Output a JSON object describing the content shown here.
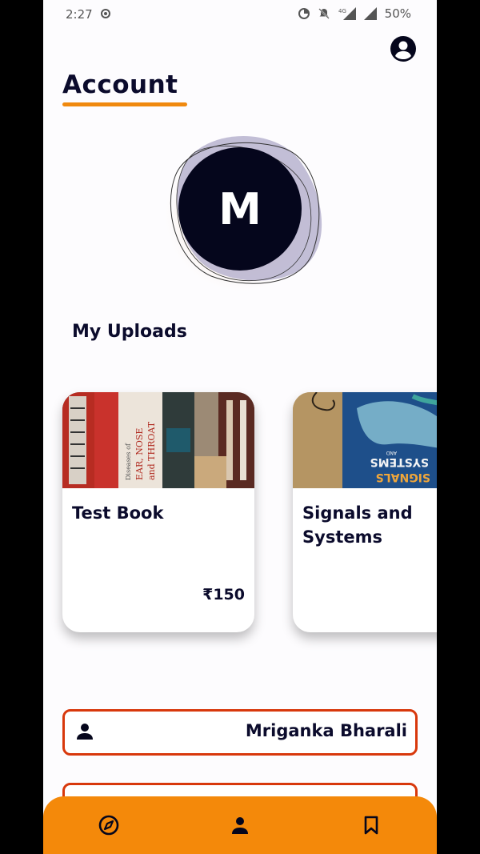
{
  "status_bar": {
    "time": "2:27",
    "battery": "50%",
    "network": "4G"
  },
  "page": {
    "title": "Account"
  },
  "avatar": {
    "initial": "M"
  },
  "uploads": {
    "heading": "My Uploads",
    "items": [
      {
        "name": "Test Book",
        "price": "₹150",
        "cover_text": [
          "Diseases of",
          "EAR, NOSE",
          "and THROAT"
        ]
      },
      {
        "name": "Signals and Systems",
        "price": "₹",
        "cover_text": [
          "SYSTEMS",
          "AND",
          "SIGNALS"
        ]
      }
    ]
  },
  "profile": {
    "name": "Mriganka Bharali"
  },
  "colors": {
    "accent": "#f4890a",
    "field_border": "#d8380c",
    "dark": "#05061c"
  },
  "bottom_nav": {
    "items": [
      "compass-icon",
      "person-icon",
      "bookmark-icon"
    ]
  }
}
